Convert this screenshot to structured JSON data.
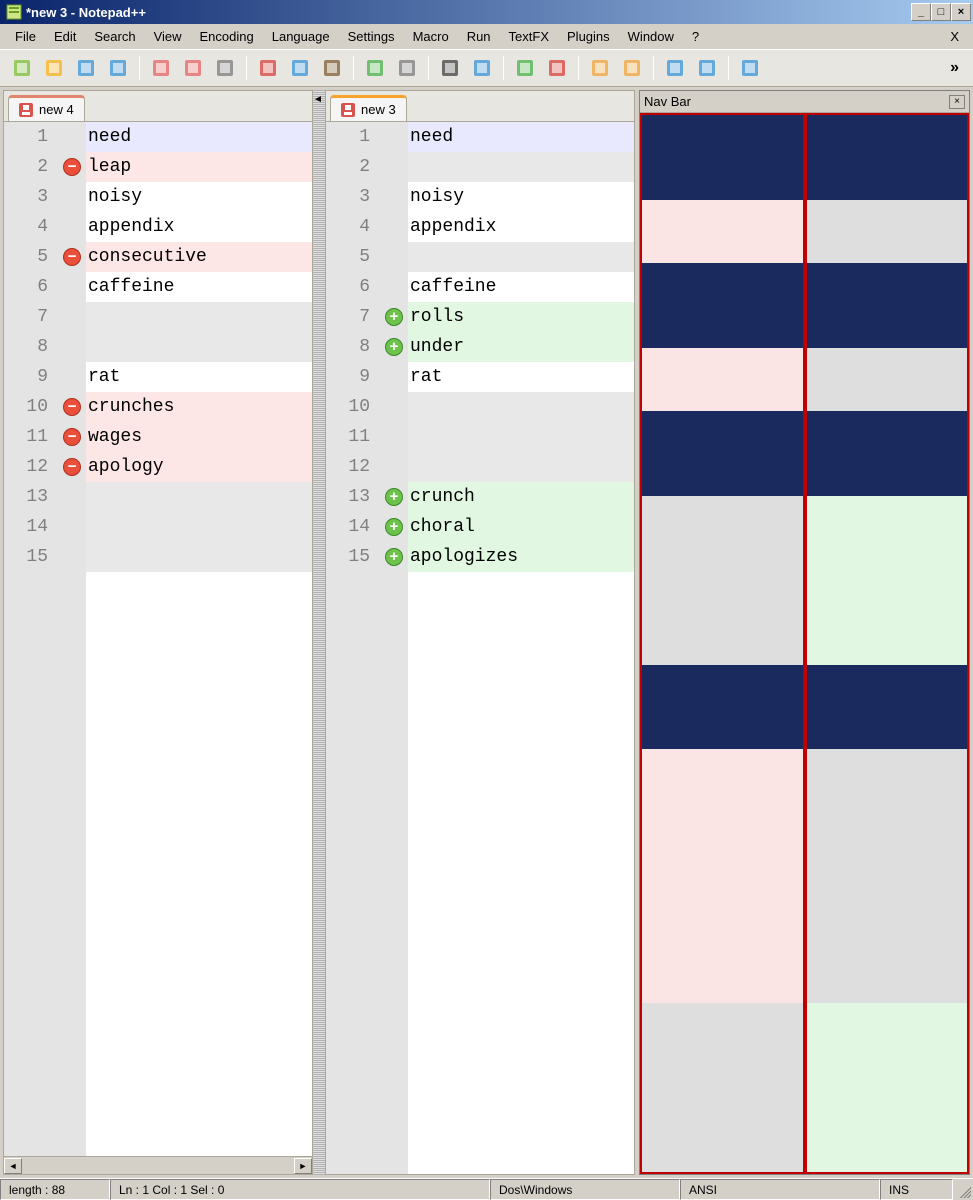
{
  "window": {
    "title": "*new  3 - Notepad++"
  },
  "menu": [
    "File",
    "Edit",
    "Search",
    "View",
    "Encoding",
    "Language",
    "Settings",
    "Macro",
    "Run",
    "TextFX",
    "Plugins",
    "Window",
    "?"
  ],
  "menu_close": "X",
  "toolbar_overflow": "»",
  "tabs": {
    "left": "new  4",
    "right": "new  3"
  },
  "left": {
    "lines": [
      {
        "n": 1,
        "text": "need",
        "hl": "cur"
      },
      {
        "n": 2,
        "text": "leap",
        "hl": "del",
        "mark": "minus"
      },
      {
        "n": 3,
        "text": "noisy",
        "hl": ""
      },
      {
        "n": 4,
        "text": "appendix",
        "hl": ""
      },
      {
        "n": 5,
        "text": "consecutive",
        "hl": "del",
        "mark": "minus"
      },
      {
        "n": 6,
        "text": "caffeine",
        "hl": ""
      },
      {
        "n": 7,
        "text": "",
        "hl": "blank"
      },
      {
        "n": 8,
        "text": "",
        "hl": "blank"
      },
      {
        "n": 9,
        "text": "rat",
        "hl": ""
      },
      {
        "n": 10,
        "text": "crunches",
        "hl": "del",
        "mark": "minus"
      },
      {
        "n": 11,
        "text": "wages",
        "hl": "del",
        "mark": "minus"
      },
      {
        "n": 12,
        "text": "apology",
        "hl": "del",
        "mark": "minus"
      },
      {
        "n": 13,
        "text": "",
        "hl": "blank"
      },
      {
        "n": 14,
        "text": "",
        "hl": "blank"
      },
      {
        "n": 15,
        "text": "",
        "hl": "blank"
      }
    ]
  },
  "right": {
    "lines": [
      {
        "n": 1,
        "text": "need",
        "hl": "cur"
      },
      {
        "n": 2,
        "text": "",
        "hl": "blank"
      },
      {
        "n": 3,
        "text": "noisy",
        "hl": ""
      },
      {
        "n": 4,
        "text": "appendix",
        "hl": ""
      },
      {
        "n": 5,
        "text": "",
        "hl": "blank"
      },
      {
        "n": 6,
        "text": "caffeine",
        "hl": ""
      },
      {
        "n": 7,
        "text": "rolls",
        "hl": "add",
        "mark": "plus"
      },
      {
        "n": 8,
        "text": "under",
        "hl": "add",
        "mark": "plus"
      },
      {
        "n": 9,
        "text": "rat",
        "hl": ""
      },
      {
        "n": 10,
        "text": "",
        "hl": "blank"
      },
      {
        "n": 11,
        "text": "",
        "hl": "blank"
      },
      {
        "n": 12,
        "text": "",
        "hl": "blank"
      },
      {
        "n": 13,
        "text": "crunch",
        "hl": "add",
        "mark": "plus"
      },
      {
        "n": 14,
        "text": "choral",
        "hl": "add",
        "mark": "plus"
      },
      {
        "n": 15,
        "text": "apologizes",
        "hl": "add",
        "mark": "plus"
      }
    ]
  },
  "navbar": {
    "title": "Nav Bar",
    "left_segments": [
      {
        "c": "navy",
        "h": 8
      },
      {
        "c": "pink",
        "h": 6
      },
      {
        "c": "navy",
        "h": 8
      },
      {
        "c": "pink",
        "h": 6
      },
      {
        "c": "navy",
        "h": 8
      },
      {
        "c": "grey",
        "h": 16
      },
      {
        "c": "navy",
        "h": 8
      },
      {
        "c": "pink",
        "h": 24
      },
      {
        "c": "grey",
        "h": 16
      }
    ],
    "right_segments": [
      {
        "c": "navy",
        "h": 8
      },
      {
        "c": "grey",
        "h": 6
      },
      {
        "c": "navy",
        "h": 8
      },
      {
        "c": "grey",
        "h": 6
      },
      {
        "c": "navy",
        "h": 8
      },
      {
        "c": "green",
        "h": 16
      },
      {
        "c": "navy",
        "h": 8
      },
      {
        "c": "grey",
        "h": 24
      },
      {
        "c": "green",
        "h": 16
      }
    ]
  },
  "status": {
    "length": "length : 88",
    "pos": "Ln : 1   Col : 1   Sel : 0",
    "eol": "Dos\\Windows",
    "enc": "ANSI",
    "mode": "INS"
  },
  "toolbar_icons": [
    "new-file-icon",
    "open-file-icon",
    "save-icon",
    "save-all-icon",
    "sep",
    "close-icon",
    "close-all-icon",
    "print-icon",
    "sep",
    "cut-icon",
    "copy-icon",
    "paste-icon",
    "sep",
    "undo-icon",
    "redo-icon",
    "sep",
    "find-icon",
    "replace-icon",
    "sep",
    "zoom-in-icon",
    "zoom-out-icon",
    "sep",
    "sync-v-icon",
    "sync-h-icon",
    "sep",
    "wrap-icon",
    "show-all-icon",
    "sep",
    "indent-guide-icon"
  ]
}
